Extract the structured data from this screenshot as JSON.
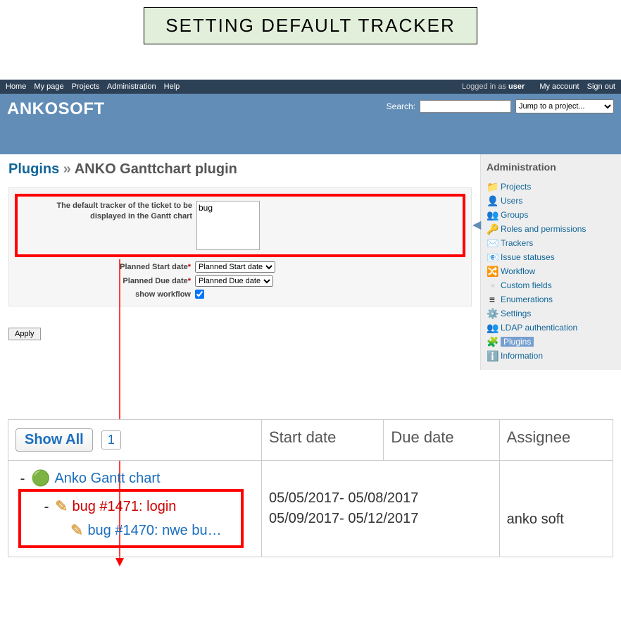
{
  "page_heading": "SETTING DEFAULT TRACKER",
  "top_menu": {
    "left": [
      "Home",
      "My page",
      "Projects",
      "Administration",
      "Help"
    ],
    "logged_prefix": "Logged in as ",
    "logged_user": "user",
    "right": [
      "My account",
      "Sign out"
    ]
  },
  "header": {
    "title": "ANKOSOFT",
    "search_label": "Search:",
    "project_select": "Jump to a project..."
  },
  "breadcrumb": {
    "root": "Plugins",
    "sep": " » ",
    "current": "ANKO Ganttchart plugin"
  },
  "settings": {
    "tracker_label": "The default tracker of the ticket to be displayed in the Gantt chart",
    "tracker_value": "bug",
    "start_label": "Planned Start date",
    "start_value": "Planned Start date",
    "due_label": "Planned Due date",
    "due_value": "Planned Due date",
    "workflow_label": "show workflow",
    "apply": "Apply"
  },
  "sidebar": {
    "title": "Administration",
    "items": [
      {
        "icon": "📁",
        "label": "Projects"
      },
      {
        "icon": "👤",
        "label": "Users"
      },
      {
        "icon": "👥",
        "label": "Groups"
      },
      {
        "icon": "🔑",
        "label": "Roles and permissions"
      },
      {
        "icon": "✉️",
        "label": "Trackers"
      },
      {
        "icon": "📧",
        "label": "Issue statuses"
      },
      {
        "icon": "🔀",
        "label": "Workflow"
      },
      {
        "icon": "▫️",
        "label": "Custom fields"
      },
      {
        "icon": "≡",
        "label": "Enumerations"
      },
      {
        "icon": "⚙️",
        "label": "Settings"
      },
      {
        "icon": "👥",
        "label": "LDAP authentication"
      },
      {
        "icon": "🧩",
        "label": "Plugins",
        "selected": true
      },
      {
        "icon": "ℹ️",
        "label": "Information"
      }
    ]
  },
  "gantt": {
    "show_all": "Show All",
    "page": "1",
    "columns": [
      "Start date",
      "Due date",
      "Assignee"
    ],
    "project": "Anko Gantt chart",
    "rows": [
      {
        "label": "bug #1471: login",
        "start": "05/05/2017",
        "due": "05/08/2017",
        "assignee": "",
        "color": "red"
      },
      {
        "label": "bug #1470: nwe bu…",
        "start": "05/09/2017",
        "due": "05/12/2017",
        "assignee": "anko soft",
        "color": "blue"
      }
    ]
  }
}
